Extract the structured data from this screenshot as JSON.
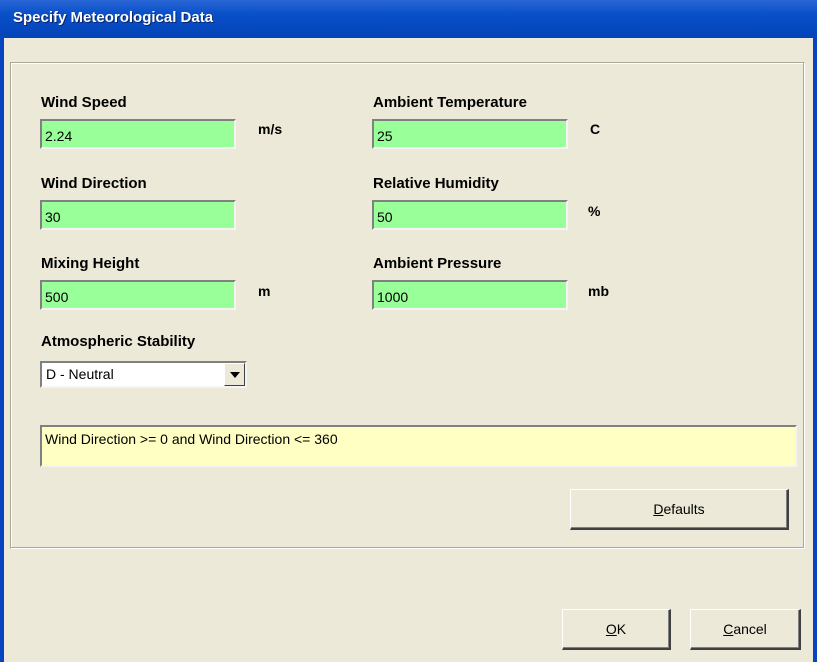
{
  "window": {
    "title": "Specify Meteorological Data"
  },
  "fields": {
    "wind_speed": {
      "label": "Wind Speed",
      "value": "2.24",
      "unit": "m/s"
    },
    "wind_direction": {
      "label": "Wind Direction",
      "value": "30",
      "unit": ""
    },
    "mixing_height": {
      "label": "Mixing Height",
      "value": "500",
      "unit": "m"
    },
    "ambient_temperature": {
      "label": "Ambient Temperature",
      "value": "25",
      "unit": "C"
    },
    "relative_humidity": {
      "label": "Relative Humidity",
      "value": "50",
      "unit": "%"
    },
    "ambient_pressure": {
      "label": "Ambient Pressure",
      "value": "1000",
      "unit": "mb"
    }
  },
  "stability": {
    "label": "Atmospheric Stability",
    "value": "D - Neutral"
  },
  "message": "Wind Direction >= 0 and Wind Direction <= 360",
  "buttons": {
    "defaults": {
      "accel": "D",
      "rest": "efaults"
    },
    "ok": {
      "accel": "O",
      "rest": "K"
    },
    "cancel": {
      "accel": "C",
      "rest": "ancel"
    }
  },
  "colors": {
    "field_bg": "#99ff99",
    "message_bg": "#ffffc4",
    "titlebar": "#0a50c9"
  }
}
